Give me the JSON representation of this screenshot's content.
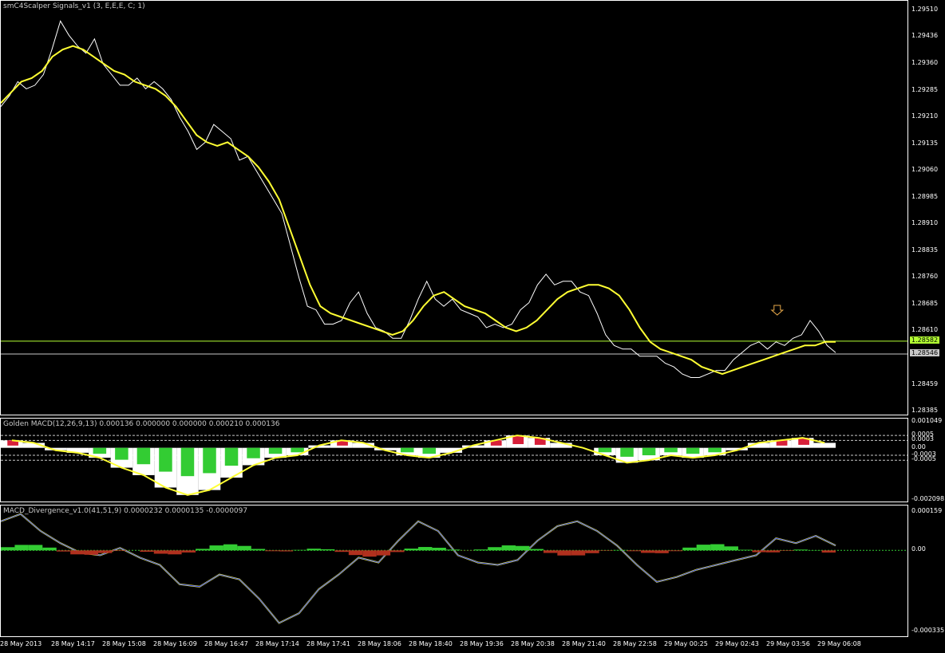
{
  "chart_data": [
    {
      "type": "line",
      "title": "smC4Scalper Signals_v1 (3, E,E,E, C; 1)",
      "ylim": [
        1.28385,
        1.2951
      ],
      "y_ticks": [
        "1.29510",
        "1.29436",
        "1.29360",
        "1.29285",
        "1.29210",
        "1.29135",
        "1.29060",
        "1.28985",
        "1.28910",
        "1.28835",
        "1.28760",
        "1.28685",
        "1.28610",
        "1.28459",
        "1.28385"
      ],
      "series": [
        {
          "name": "",
          "color": "#ffffff",
          "values": [
            1.2924,
            1.2927,
            1.2931,
            1.2929,
            1.293,
            1.2933,
            1.294,
            1.2948,
            1.2944,
            1.2941,
            1.2939,
            1.2943,
            1.2936,
            1.2933,
            1.293,
            1.293,
            1.2932,
            1.2929,
            1.2931,
            1.2929,
            1.2926,
            1.2921,
            1.2917,
            1.2912,
            1.2914,
            1.2919,
            1.2917,
            1.2915,
            1.2909,
            1.291,
            1.2906,
            1.2902,
            1.2898,
            1.2894,
            1.2885,
            1.2876,
            1.2868,
            1.2867,
            1.2863,
            1.2863,
            1.2864,
            1.2869,
            1.2872,
            1.2866,
            1.2862,
            1.2861,
            1.2859,
            1.2859,
            1.2864,
            1.287,
            1.2875,
            1.287,
            1.2868,
            1.287,
            1.2867,
            1.2866,
            1.2865,
            1.2862,
            1.2863,
            1.2862,
            1.2863,
            1.2867,
            1.2869,
            1.2874,
            1.2877,
            1.2874,
            1.2875,
            1.2875,
            1.2872,
            1.2871,
            1.2866,
            1.286,
            1.2857,
            1.2856,
            1.2856,
            1.2854,
            1.2854,
            1.2854,
            1.2852,
            1.2851,
            1.2849,
            1.2848,
            1.2848,
            1.2849,
            1.285,
            1.285,
            1.2853,
            1.2855,
            1.2857,
            1.2858,
            1.2856,
            1.2858,
            1.2857,
            1.2859,
            1.286,
            1.2864,
            1.2861,
            1.2857,
            1.2855
          ]
        },
        {
          "name": "",
          "color": "#ffff33",
          "values": [
            1.2925,
            1.2928,
            1.2931,
            1.2932,
            1.2934,
            1.2938,
            1.294,
            1.2941,
            1.294,
            1.2938,
            1.2936,
            1.2934,
            1.2933,
            1.2931,
            1.293,
            1.2929,
            1.2927,
            1.2924,
            1.292,
            1.2916,
            1.2914,
            1.2913,
            1.2914,
            1.2912,
            1.291,
            1.2907,
            1.2903,
            1.2898,
            1.289,
            1.2882,
            1.2874,
            1.2868,
            1.2866,
            1.2865,
            1.2864,
            1.2863,
            1.2862,
            1.2861,
            1.286,
            1.2861,
            1.2864,
            1.2868,
            1.2871,
            1.2872,
            1.287,
            1.2868,
            1.2867,
            1.2866,
            1.2864,
            1.2862,
            1.2861,
            1.2862,
            1.2864,
            1.2867,
            1.287,
            1.2872,
            1.2873,
            1.2874,
            1.2874,
            1.2873,
            1.2871,
            1.2867,
            1.2862,
            1.2858,
            1.2856,
            1.2855,
            1.2854,
            1.2853,
            1.2851,
            1.285,
            1.2849,
            1.285,
            1.2851,
            1.2852,
            1.2853,
            1.2854,
            1.2855,
            1.2856,
            1.2857,
            1.2857,
            1.2858,
            1.2858
          ]
        }
      ],
      "hlines": [
        {
          "y": 1.28582,
          "color": "#b3ff33",
          "label": "1.28582"
        },
        {
          "y": 1.28546,
          "color": "#c8c8c8",
          "label": "1.28546"
        }
      ]
    },
    {
      "type": "bar",
      "title": "Golden MACD(12,26,9,13) 0.000136 0.000000 0.000000 0.000210 0.000136",
      "ylim": [
        -0.002098,
        0.001049
      ],
      "y_ticks": [
        "0.001049",
        "0.0005",
        "0.0003",
        "0.00",
        "-0.0003",
        "-0.0005",
        "-0.002098"
      ],
      "levels": [
        0.0005,
        0.0003,
        -0.0003,
        -0.0005
      ],
      "values": [
        0.0003,
        0.0002,
        -0.0001,
        -0.0002,
        -0.0004,
        -0.0008,
        -0.0011,
        -0.0016,
        -0.0019,
        -0.0017,
        -0.0012,
        -0.0007,
        -0.0004,
        -0.0003,
        0.0001,
        0.0003,
        0.0002,
        -0.0001,
        -0.0003,
        -0.0004,
        -0.0002,
        0.0001,
        0.0003,
        0.0005,
        0.0004,
        0.0002,
        0.0,
        -0.0003,
        -0.0006,
        -0.0005,
        -0.0003,
        -0.0004,
        -0.0003,
        -0.0001,
        0.0002,
        0.0003,
        0.0004,
        0.0002
      ]
    },
    {
      "type": "line",
      "title": "MACD_Divergence_v1.0(41,51,9) 0.0000232 0.0000135 -0.0000097",
      "ylim": [
        -0.000335,
        0.000159
      ],
      "y_ticks": [
        "0.000159",
        "0.00",
        "-0.000335"
      ],
      "series": [
        {
          "name": "",
          "color": "#3040ff",
          "values": [
            0.00012,
            0.00015,
            8e-05,
            3e-05,
            -1e-05,
            -2e-05,
            1e-05,
            -3e-05,
            -6e-05,
            -0.00014,
            -0.00015,
            -0.0001,
            -0.00012,
            -0.0002,
            -0.0003,
            -0.00026,
            -0.00016,
            -0.0001,
            -3e-05,
            -5e-05,
            4e-05,
            0.00012,
            8e-05,
            -2e-05,
            -5e-05,
            -6e-05,
            -4e-05,
            4e-05,
            0.0001,
            0.00012,
            8e-05,
            2e-05,
            -6e-05,
            -0.00013,
            -0.00011,
            -8e-05,
            -6e-05,
            -4e-05,
            -2e-05,
            5e-05,
            3e-05,
            6e-05,
            2e-05
          ]
        }
      ]
    }
  ],
  "time_labels": [
    "28 May 2013",
    "28 May 14:17",
    "28 May 15:08",
    "28 May 16:09",
    "28 May 16:47",
    "28 May 17:14",
    "28 May 17:41",
    "28 May 18:06",
    "28 May 18:40",
    "28 May 19:36",
    "28 May 20:38",
    "28 May 21:40",
    "28 May 22:58",
    "29 May 00:25",
    "29 May 02:43",
    "29 May 03:56",
    "29 May 06:08"
  ]
}
